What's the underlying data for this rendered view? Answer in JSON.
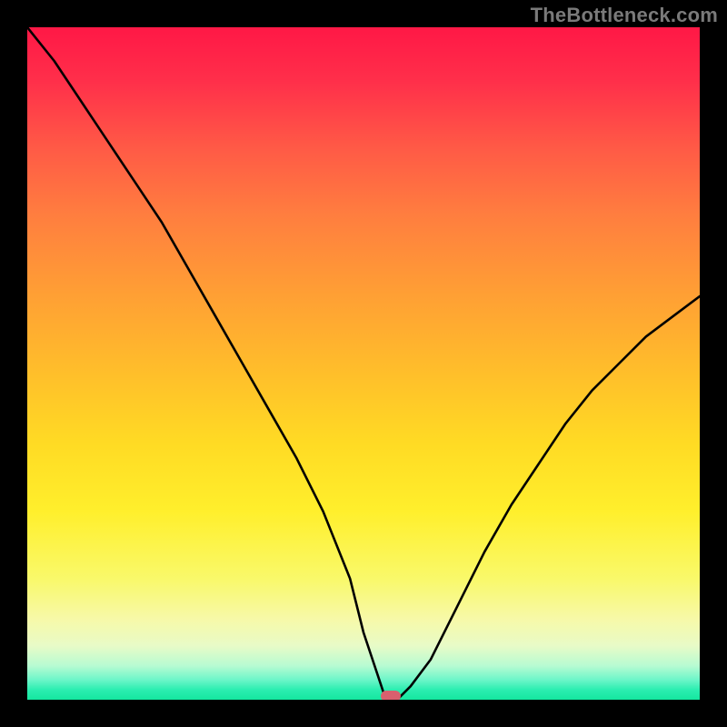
{
  "watermark": "TheBottleneck.com",
  "chart_data": {
    "type": "line",
    "title": "",
    "xlabel": "",
    "ylabel": "",
    "xlim": [
      0,
      100
    ],
    "ylim": [
      0,
      100
    ],
    "grid": false,
    "legend": false,
    "series": [
      {
        "name": "bottleneck-curve",
        "x": [
          0,
          4,
          8,
          12,
          16,
          20,
          24,
          28,
          32,
          36,
          40,
          44,
          48,
          50,
          52,
          53,
          54,
          55,
          57,
          60,
          64,
          68,
          72,
          76,
          80,
          84,
          88,
          92,
          96,
          100
        ],
        "values": [
          100,
          95,
          89,
          83,
          77,
          71,
          64,
          57,
          50,
          43,
          36,
          28,
          18,
          10,
          4,
          1,
          0,
          0,
          2,
          6,
          14,
          22,
          29,
          35,
          41,
          46,
          50,
          54,
          57,
          60
        ]
      }
    ],
    "marker": {
      "x": 54,
      "y": 0
    },
    "background_gradient": {
      "type": "vertical",
      "stops": [
        {
          "pos": 0,
          "color": "#ff1846"
        },
        {
          "pos": 50,
          "color": "#ffc02a"
        },
        {
          "pos": 85,
          "color": "#f7f98a"
        },
        {
          "pos": 100,
          "color": "#14e79f"
        }
      ]
    }
  }
}
